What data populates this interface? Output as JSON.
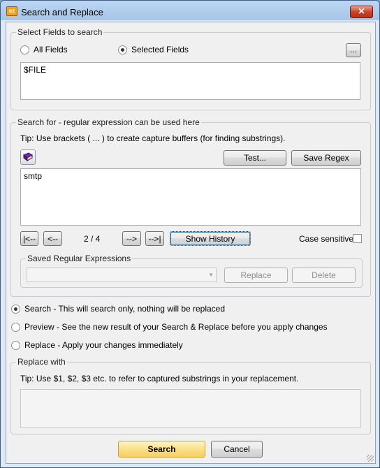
{
  "window": {
    "title": "Search and Replace",
    "app_icon": "ez",
    "close_glyph": "✕"
  },
  "fields_group": {
    "label": "Select Fields to search",
    "all_fields": "All Fields",
    "selected_fields": "Selected Fields",
    "browse_label": "...",
    "fields_value": "$FILE"
  },
  "search_group": {
    "label": "Search for - regular expression can be used here",
    "tip": "Tip: Use brackets ( ... ) to create capture buffers (for finding substrings).",
    "test_label": "Test...",
    "save_regex_label": "Save Regex",
    "search_text": "smtp",
    "nav_first": "|<--",
    "nav_prev": "<--",
    "position": "2 / 4",
    "nav_next": "-->",
    "nav_last": "-->|",
    "show_history_label": "Show History",
    "case_sensitive_label": "Case sensitive",
    "saved_label": "Saved Regular Expressions",
    "replace_label": "Replace",
    "delete_label": "Delete"
  },
  "mode": {
    "search": "Search - This will search only, nothing will be replaced",
    "preview": "Preview - See the new result of your Search & Replace before you apply changes",
    "replace": "Replace - Apply your changes immediately",
    "selected": "search"
  },
  "replace_group": {
    "label": "Replace with",
    "tip": "Tip: Use $1, $2, $3 etc. to refer to captured substrings in your replacement.",
    "value": ""
  },
  "footer": {
    "search_label": "Search",
    "cancel_label": "Cancel"
  },
  "colors": {
    "primary_button": "#fbe08a",
    "close_button": "#c8442a",
    "title_bar": "#a7c5e8"
  }
}
